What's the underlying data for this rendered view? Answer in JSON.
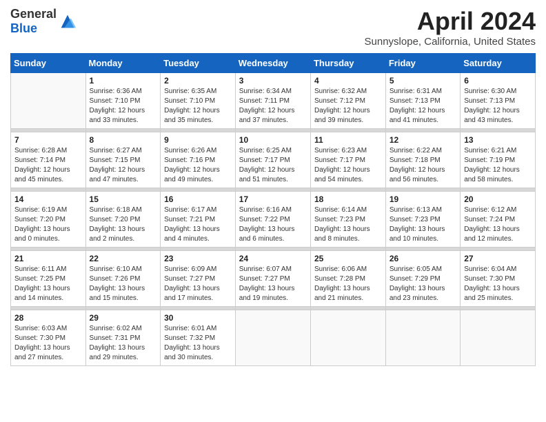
{
  "header": {
    "logo_general": "General",
    "logo_blue": "Blue",
    "title": "April 2024",
    "location": "Sunnyslope, California, United States"
  },
  "weekdays": [
    "Sunday",
    "Monday",
    "Tuesday",
    "Wednesday",
    "Thursday",
    "Friday",
    "Saturday"
  ],
  "weeks": [
    [
      {
        "day": "",
        "empty": true
      },
      {
        "day": "1",
        "sunrise": "Sunrise: 6:36 AM",
        "sunset": "Sunset: 7:10 PM",
        "daylight": "Daylight: 12 hours and 33 minutes."
      },
      {
        "day": "2",
        "sunrise": "Sunrise: 6:35 AM",
        "sunset": "Sunset: 7:10 PM",
        "daylight": "Daylight: 12 hours and 35 minutes."
      },
      {
        "day": "3",
        "sunrise": "Sunrise: 6:34 AM",
        "sunset": "Sunset: 7:11 PM",
        "daylight": "Daylight: 12 hours and 37 minutes."
      },
      {
        "day": "4",
        "sunrise": "Sunrise: 6:32 AM",
        "sunset": "Sunset: 7:12 PM",
        "daylight": "Daylight: 12 hours and 39 minutes."
      },
      {
        "day": "5",
        "sunrise": "Sunrise: 6:31 AM",
        "sunset": "Sunset: 7:13 PM",
        "daylight": "Daylight: 12 hours and 41 minutes."
      },
      {
        "day": "6",
        "sunrise": "Sunrise: 6:30 AM",
        "sunset": "Sunset: 7:13 PM",
        "daylight": "Daylight: 12 hours and 43 minutes."
      }
    ],
    [
      {
        "day": "7",
        "sunrise": "Sunrise: 6:28 AM",
        "sunset": "Sunset: 7:14 PM",
        "daylight": "Daylight: 12 hours and 45 minutes."
      },
      {
        "day": "8",
        "sunrise": "Sunrise: 6:27 AM",
        "sunset": "Sunset: 7:15 PM",
        "daylight": "Daylight: 12 hours and 47 minutes."
      },
      {
        "day": "9",
        "sunrise": "Sunrise: 6:26 AM",
        "sunset": "Sunset: 7:16 PM",
        "daylight": "Daylight: 12 hours and 49 minutes."
      },
      {
        "day": "10",
        "sunrise": "Sunrise: 6:25 AM",
        "sunset": "Sunset: 7:17 PM",
        "daylight": "Daylight: 12 hours and 51 minutes."
      },
      {
        "day": "11",
        "sunrise": "Sunrise: 6:23 AM",
        "sunset": "Sunset: 7:17 PM",
        "daylight": "Daylight: 12 hours and 54 minutes."
      },
      {
        "day": "12",
        "sunrise": "Sunrise: 6:22 AM",
        "sunset": "Sunset: 7:18 PM",
        "daylight": "Daylight: 12 hours and 56 minutes."
      },
      {
        "day": "13",
        "sunrise": "Sunrise: 6:21 AM",
        "sunset": "Sunset: 7:19 PM",
        "daylight": "Daylight: 12 hours and 58 minutes."
      }
    ],
    [
      {
        "day": "14",
        "sunrise": "Sunrise: 6:19 AM",
        "sunset": "Sunset: 7:20 PM",
        "daylight": "Daylight: 13 hours and 0 minutes."
      },
      {
        "day": "15",
        "sunrise": "Sunrise: 6:18 AM",
        "sunset": "Sunset: 7:20 PM",
        "daylight": "Daylight: 13 hours and 2 minutes."
      },
      {
        "day": "16",
        "sunrise": "Sunrise: 6:17 AM",
        "sunset": "Sunset: 7:21 PM",
        "daylight": "Daylight: 13 hours and 4 minutes."
      },
      {
        "day": "17",
        "sunrise": "Sunrise: 6:16 AM",
        "sunset": "Sunset: 7:22 PM",
        "daylight": "Daylight: 13 hours and 6 minutes."
      },
      {
        "day": "18",
        "sunrise": "Sunrise: 6:14 AM",
        "sunset": "Sunset: 7:23 PM",
        "daylight": "Daylight: 13 hours and 8 minutes."
      },
      {
        "day": "19",
        "sunrise": "Sunrise: 6:13 AM",
        "sunset": "Sunset: 7:23 PM",
        "daylight": "Daylight: 13 hours and 10 minutes."
      },
      {
        "day": "20",
        "sunrise": "Sunrise: 6:12 AM",
        "sunset": "Sunset: 7:24 PM",
        "daylight": "Daylight: 13 hours and 12 minutes."
      }
    ],
    [
      {
        "day": "21",
        "sunrise": "Sunrise: 6:11 AM",
        "sunset": "Sunset: 7:25 PM",
        "daylight": "Daylight: 13 hours and 14 minutes."
      },
      {
        "day": "22",
        "sunrise": "Sunrise: 6:10 AM",
        "sunset": "Sunset: 7:26 PM",
        "daylight": "Daylight: 13 hours and 15 minutes."
      },
      {
        "day": "23",
        "sunrise": "Sunrise: 6:09 AM",
        "sunset": "Sunset: 7:27 PM",
        "daylight": "Daylight: 13 hours and 17 minutes."
      },
      {
        "day": "24",
        "sunrise": "Sunrise: 6:07 AM",
        "sunset": "Sunset: 7:27 PM",
        "daylight": "Daylight: 13 hours and 19 minutes."
      },
      {
        "day": "25",
        "sunrise": "Sunrise: 6:06 AM",
        "sunset": "Sunset: 7:28 PM",
        "daylight": "Daylight: 13 hours and 21 minutes."
      },
      {
        "day": "26",
        "sunrise": "Sunrise: 6:05 AM",
        "sunset": "Sunset: 7:29 PM",
        "daylight": "Daylight: 13 hours and 23 minutes."
      },
      {
        "day": "27",
        "sunrise": "Sunrise: 6:04 AM",
        "sunset": "Sunset: 7:30 PM",
        "daylight": "Daylight: 13 hours and 25 minutes."
      }
    ],
    [
      {
        "day": "28",
        "sunrise": "Sunrise: 6:03 AM",
        "sunset": "Sunset: 7:30 PM",
        "daylight": "Daylight: 13 hours and 27 minutes."
      },
      {
        "day": "29",
        "sunrise": "Sunrise: 6:02 AM",
        "sunset": "Sunset: 7:31 PM",
        "daylight": "Daylight: 13 hours and 29 minutes."
      },
      {
        "day": "30",
        "sunrise": "Sunrise: 6:01 AM",
        "sunset": "Sunset: 7:32 PM",
        "daylight": "Daylight: 13 hours and 30 minutes."
      },
      {
        "day": "",
        "empty": true
      },
      {
        "day": "",
        "empty": true
      },
      {
        "day": "",
        "empty": true
      },
      {
        "day": "",
        "empty": true
      }
    ]
  ]
}
